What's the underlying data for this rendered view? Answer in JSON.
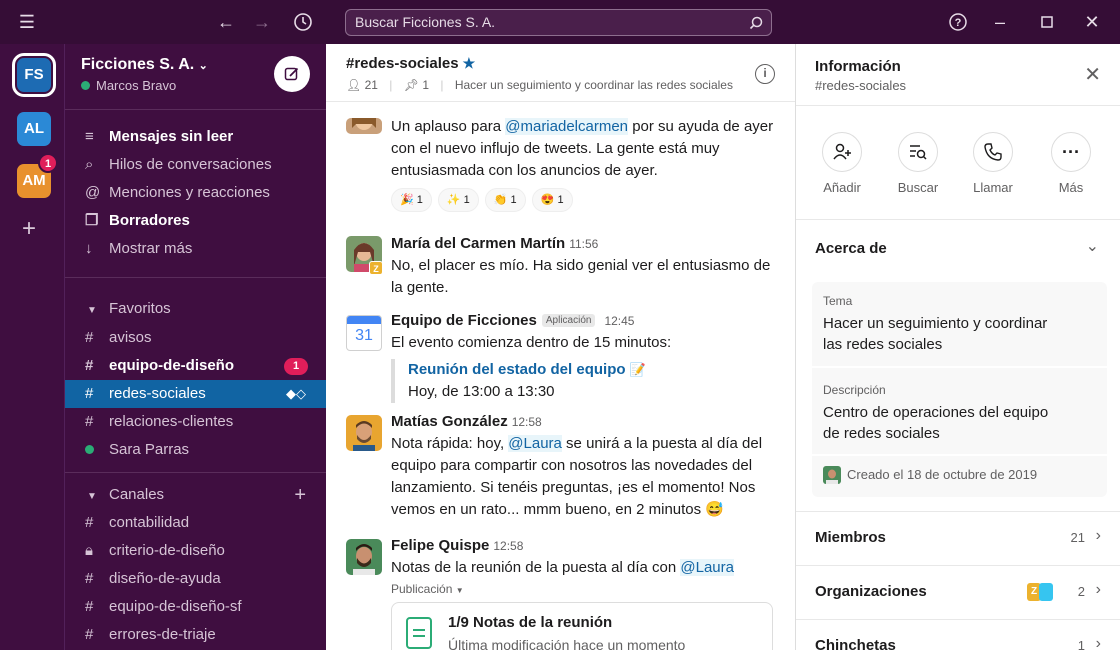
{
  "search": {
    "placeholder": "Buscar Ficciones S. A."
  },
  "rail": {
    "workspaces": [
      {
        "initials": "FS",
        "color": "#1d6bb3"
      },
      {
        "initials": "AL",
        "color": "#2b89d6"
      },
      {
        "initials": "AM",
        "color": "#e8912d",
        "badge": "1"
      }
    ]
  },
  "sidebar": {
    "workspace_name": "Ficciones S. A.",
    "user_name": "Marcos Bravo",
    "nav": [
      {
        "label": "Mensajes sin leer"
      },
      {
        "label": "Hilos de conversaciones"
      },
      {
        "label": "Menciones y reacciones"
      },
      {
        "label": "Borradores"
      },
      {
        "label": "Mostrar más"
      }
    ],
    "favorites_label": "Favoritos",
    "favorites": [
      {
        "label": "avisos"
      },
      {
        "label": "equipo-de-diseño",
        "badge": "1"
      },
      {
        "label": "redes-sociales"
      },
      {
        "label": "relaciones-clientes"
      },
      {
        "label": "Sara Parras"
      }
    ],
    "channels_label": "Canales",
    "channels": [
      {
        "label": "contabilidad"
      },
      {
        "label": "criterio-de-diseño"
      },
      {
        "label": "diseño-de-ayuda"
      },
      {
        "label": "equipo-de-diseño-sf"
      },
      {
        "label": "errores-de-triaje"
      }
    ]
  },
  "channel": {
    "name": "#redes-sociales",
    "members": "21",
    "pins": "1",
    "topic": "Hacer un seguimiento y coordinar las redes sociales"
  },
  "messages": {
    "m0": {
      "text_pre": "Un aplauso para ",
      "mention": "@mariadelcarmen",
      "text_post": " por su ayuda de ayer con el nuevo influjo de tweets. La gente está muy entusiasmada con los anuncios de ayer.",
      "reactions": [
        {
          "emoji": "🎉",
          "count": "1"
        },
        {
          "emoji": "✨",
          "count": "1"
        },
        {
          "emoji": "👏",
          "count": "1"
        },
        {
          "emoji": "😍",
          "count": "1"
        }
      ]
    },
    "m1": {
      "author": "María del Carmen Martín",
      "time": "11:56",
      "text": "No, el placer es mío. Ha sido genial ver el entusiasmo de la gente."
    },
    "m2": {
      "author": "Equipo de Ficciones",
      "app_tag": "Aplicación",
      "time": "12:45",
      "calendar_day": "31",
      "text": "El evento comienza dentro de 15 minutos:",
      "event_title": "Reunión del estado del equipo",
      "event_emoji": "📝",
      "event_time": "Hoy, de 13:00 a 13:30"
    },
    "m3": {
      "author": "Matías González",
      "time": "12:58",
      "text_pre": "Nota rápida: hoy, ",
      "mention": "@Laura",
      "text_post": " se unirá a la puesta al día del equipo para compartir con nosotros las novedades del lanzamiento. Si tenéis preguntas, ¡es el momento! Nos vemos en un rato... mmm bueno, en 2 minutos 😅"
    },
    "m4": {
      "author": "Felipe Quispe",
      "time": "12:58",
      "text_pre": "Notas de la reunión de la puesta al día con ",
      "mention": "@Laura",
      "pub_label": "Publicación",
      "file_title": "1/9 Notas de la reunión",
      "file_sub": "Última modificación hace un momento"
    }
  },
  "panel": {
    "title": "Información",
    "subtitle": "#redes-sociales",
    "actions": [
      {
        "label": "Añadir"
      },
      {
        "label": "Buscar"
      },
      {
        "label": "Llamar"
      },
      {
        "label": "Más"
      }
    ],
    "about_title": "Acerca de",
    "topic_label": "Tema",
    "topic_value": "Hacer un seguimiento y coordinar las redes sociales",
    "desc_label": "Descripción",
    "desc_value": "Centro de operaciones del equipo de redes sociales",
    "created": "Creado el 18 de octubre de 2019",
    "members_label": "Miembros",
    "members_count": "21",
    "orgs_label": "Organizaciones",
    "orgs_badge": "Z",
    "orgs_count": "2",
    "pins_label": "Chinchetas",
    "pins_count": "1"
  }
}
